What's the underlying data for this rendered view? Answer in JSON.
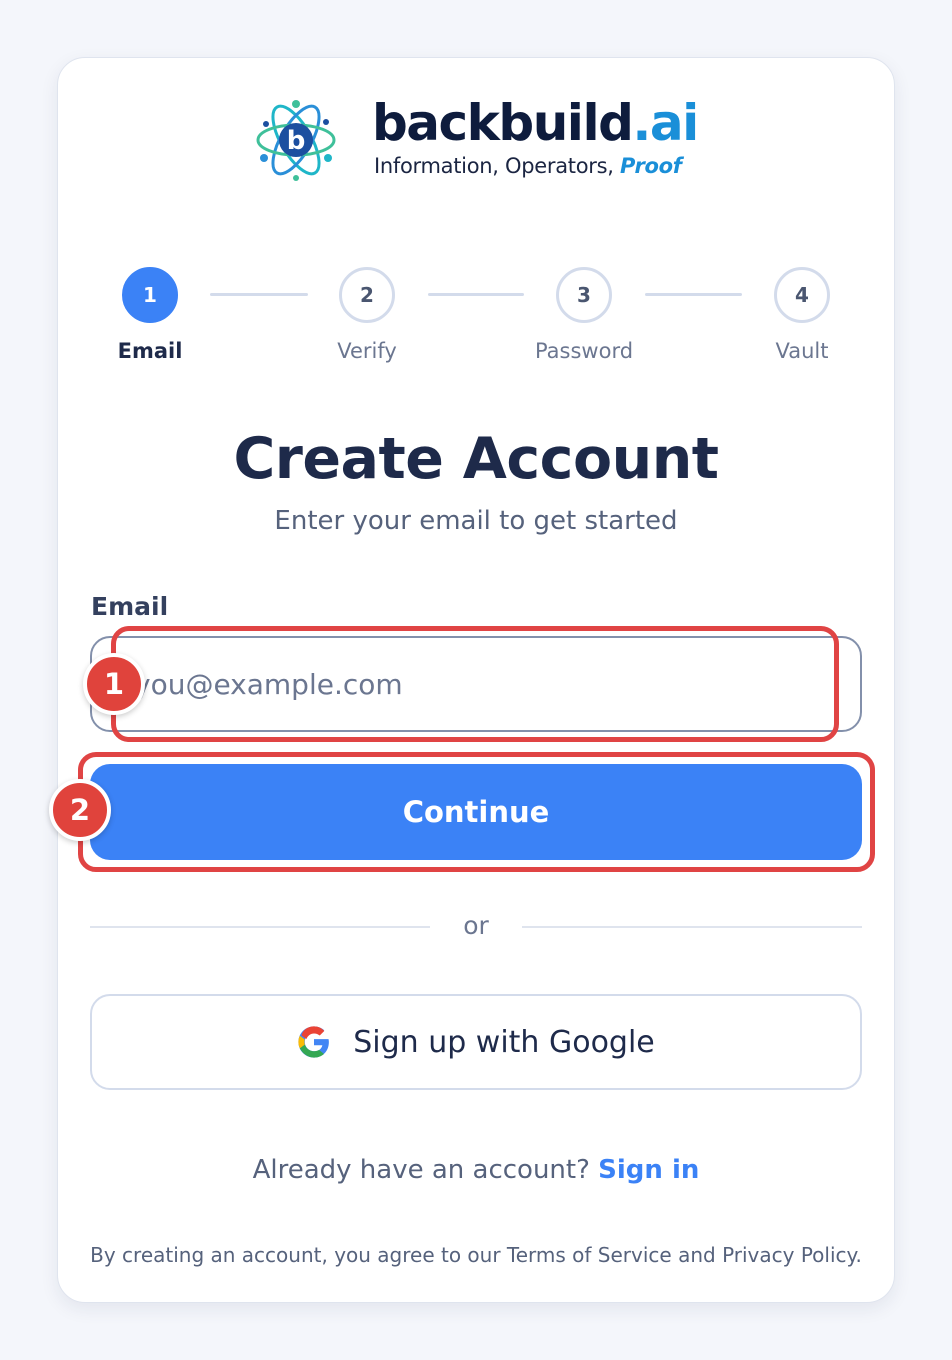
{
  "brand": {
    "name_main": "backbuild",
    "name_suffix": ".ai",
    "tagline_main": "Information, Operators, ",
    "tagline_accent": "Proof",
    "logo_icon": "atom-network-logo-icon"
  },
  "stepper": {
    "steps": [
      {
        "number": "1",
        "label": "Email",
        "state": "active"
      },
      {
        "number": "2",
        "label": "Verify",
        "state": "pending"
      },
      {
        "number": "3",
        "label": "Password",
        "state": "pending"
      },
      {
        "number": "4",
        "label": "Vault",
        "state": "pending"
      }
    ]
  },
  "header": {
    "title": "Create Account",
    "subtitle": "Enter your email to get started"
  },
  "form": {
    "email_label": "Email",
    "email_placeholder": "you@example.com",
    "email_value": "",
    "continue_label": "Continue"
  },
  "divider": {
    "text": "or"
  },
  "google": {
    "label": "Sign up with Google",
    "icon": "google-icon"
  },
  "footer": {
    "signin_prompt": "Already have an account?",
    "signin_link": "Sign in",
    "legal": "By creating an account, you agree to our Terms of Service and Privacy Policy."
  },
  "annotations": [
    {
      "number": "1",
      "target": "email-input"
    },
    {
      "number": "2",
      "target": "continue-button"
    }
  ],
  "colors": {
    "primary": "#3b82f6",
    "annotation_red": "#e0433c",
    "brand_accent": "#1a8fd8",
    "text_dark": "#1e2a4a"
  }
}
